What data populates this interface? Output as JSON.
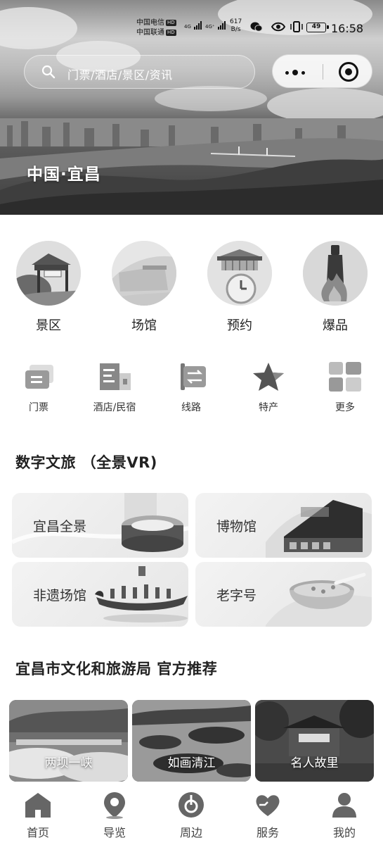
{
  "status_bar": {
    "carrier_1": "中国电信",
    "carrier_2": "中国联通",
    "hd_badge": "HD",
    "network_1": "4G",
    "network_2": "4G⁺",
    "speed_value": "617",
    "speed_unit": "B/s",
    "battery": "49",
    "time": "16:58"
  },
  "header": {
    "search_placeholder": "门票/酒店/景区/资讯",
    "city_title": "中国·宜昌"
  },
  "big_categories": [
    {
      "label": "景区",
      "icon": "scenic-gate-icon"
    },
    {
      "label": "场馆",
      "icon": "venue-building-icon"
    },
    {
      "label": "预约",
      "icon": "reservation-clock-icon"
    },
    {
      "label": "爆品",
      "icon": "hot-product-icon"
    }
  ],
  "small_categories": [
    {
      "label": "门票",
      "icon": "ticket-icon"
    },
    {
      "label": "酒店/民宿",
      "icon": "hotel-icon"
    },
    {
      "label": "线路",
      "icon": "route-icon"
    },
    {
      "label": "特产",
      "icon": "star-icon"
    },
    {
      "label": "更多",
      "icon": "grid-more-icon"
    }
  ],
  "vr_section": {
    "title": "数字文旅 （全景VR)",
    "cards": [
      {
        "label": "宜昌全景"
      },
      {
        "label": "博物馆"
      },
      {
        "label": "非遗场馆"
      },
      {
        "label": "老字号"
      }
    ]
  },
  "recommend_section": {
    "title": "宜昌市文化和旅游局 官方推荐",
    "items": [
      {
        "label": "两坝一峡"
      },
      {
        "label": "如画清江"
      },
      {
        "label": "名人故里"
      }
    ]
  },
  "tab_bar": [
    {
      "label": "首页",
      "icon": "home-icon"
    },
    {
      "label": "导览",
      "icon": "location-pin-icon"
    },
    {
      "label": "周边",
      "icon": "nearby-icon"
    },
    {
      "label": "服务",
      "icon": "heart-icon"
    },
    {
      "label": "我的",
      "icon": "user-icon"
    }
  ]
}
